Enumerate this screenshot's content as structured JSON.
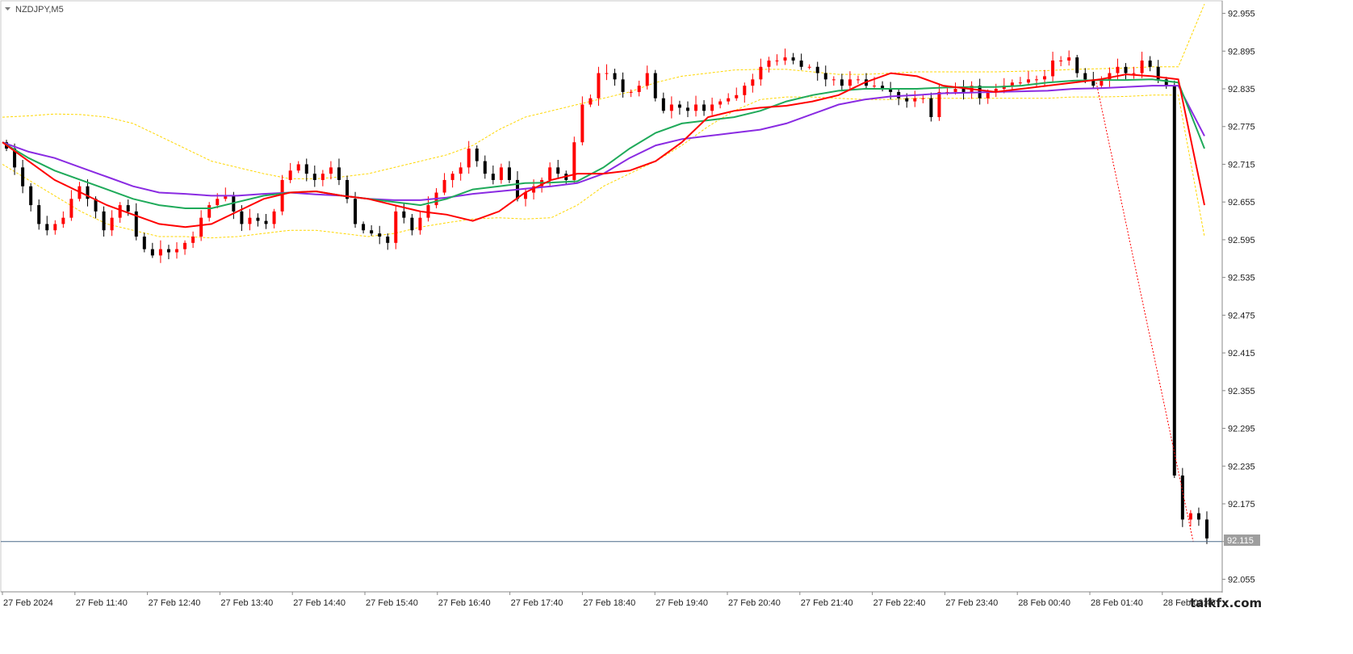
{
  "symbol_label": "NZDJPY,M5",
  "watermark": "talkfx.com",
  "colors": {
    "bull": "#ff0000",
    "bear": "#000000",
    "ma_fast": "#ff0000",
    "ma_mid": "#1faa5a",
    "ma_slow": "#8a2be2",
    "envelope": "#ffd700",
    "price_line": "#4a6a8a",
    "price_box": "#9e9e9e",
    "grid": "#e8e8e8",
    "dotted_trend": "#ff0000"
  },
  "chart_data": {
    "type": "candlestick",
    "title": "NZDJPY,M5",
    "ylim": [
      92.035,
      92.975
    ],
    "y_ticks": [
      "92.955",
      "92.895",
      "92.835",
      "92.775",
      "92.715",
      "92.655",
      "92.595",
      "92.535",
      "92.475",
      "92.415",
      "92.355",
      "92.295",
      "92.235",
      "92.175",
      "92.115",
      "92.055"
    ],
    "x_ticks": [
      "27 Feb 2024",
      "27 Feb 11:40",
      "27 Feb 12:40",
      "27 Feb 13:40",
      "27 Feb 14:40",
      "27 Feb 15:40",
      "27 Feb 16:40",
      "27 Feb 17:40",
      "27 Feb 18:40",
      "27 Feb 19:40",
      "27 Feb 20:40",
      "27 Feb 21:40",
      "27 Feb 22:40",
      "27 Feb 23:40",
      "28 Feb 00:40",
      "28 Feb 01:40",
      "28 Feb 02:40"
    ],
    "current_price": "92.115",
    "candle_closes": [
      92.74,
      92.71,
      92.68,
      92.65,
      92.62,
      92.61,
      92.62,
      92.63,
      92.66,
      92.68,
      92.66,
      92.64,
      92.61,
      92.63,
      92.65,
      92.64,
      92.6,
      92.58,
      92.57,
      92.58,
      92.575,
      92.58,
      92.59,
      92.6,
      92.63,
      92.65,
      92.66,
      92.665,
      92.64,
      92.62,
      92.63,
      92.625,
      92.62,
      92.64,
      92.69,
      92.705,
      92.715,
      92.7,
      92.69,
      92.7,
      92.71,
      92.69,
      92.66,
      92.62,
      92.61,
      92.605,
      92.6,
      92.59,
      92.64,
      92.63,
      92.61,
      92.63,
      92.65,
      92.67,
      92.69,
      92.7,
      92.71,
      92.74,
      92.72,
      92.7,
      92.69,
      92.71,
      92.69,
      92.66,
      92.67,
      92.68,
      92.69,
      92.71,
      92.7,
      92.69,
      92.75,
      92.81,
      92.82,
      92.86,
      92.86,
      92.85,
      92.83,
      92.83,
      92.84,
      92.86,
      92.82,
      92.8,
      92.81,
      92.805,
      92.8,
      92.81,
      92.8,
      92.81,
      92.815,
      92.82,
      92.825,
      92.84,
      92.85,
      92.87,
      92.88,
      92.88,
      92.885,
      92.88,
      92.87,
      92.87,
      92.86,
      92.85,
      92.85,
      92.84,
      92.85,
      92.85,
      92.84,
      92.84,
      92.835,
      92.83,
      92.82,
      92.815,
      92.82,
      92.82,
      92.79,
      92.83,
      92.83,
      92.835,
      92.83,
      92.84,
      92.82,
      92.83,
      92.835,
      92.84,
      92.845,
      92.845,
      92.85,
      92.85,
      92.855,
      92.88,
      92.88,
      92.885,
      92.86,
      92.85,
      92.84,
      92.85,
      92.86,
      92.87,
      92.86,
      92.86,
      92.88,
      92.87,
      92.85,
      92.84,
      92.22,
      92.15,
      92.16,
      92.15,
      92.12
    ],
    "ma_fast_values": [
      92.75,
      92.72,
      92.69,
      92.67,
      92.65,
      92.635,
      92.62,
      92.615,
      92.62,
      92.64,
      92.66,
      92.67,
      92.672,
      92.665,
      92.66,
      92.65,
      92.64,
      92.635,
      92.625,
      92.64,
      92.67,
      92.69,
      92.7,
      92.7,
      92.705,
      92.72,
      92.75,
      92.79,
      92.8,
      92.805,
      92.808,
      92.815,
      92.825,
      92.845,
      92.86,
      92.855,
      92.84,
      92.835,
      92.83,
      92.835,
      92.84,
      92.845,
      92.85,
      92.858,
      92.855,
      92.85,
      92.65
    ],
    "ma_mid_values": [
      92.75,
      92.725,
      92.705,
      92.69,
      92.675,
      92.66,
      92.65,
      92.645,
      92.645,
      92.655,
      92.665,
      92.67,
      92.672,
      92.665,
      92.66,
      92.655,
      92.65,
      92.66,
      92.675,
      92.68,
      92.685,
      92.686,
      92.688,
      92.71,
      92.74,
      92.765,
      92.78,
      92.785,
      92.79,
      92.8,
      92.815,
      92.825,
      92.832,
      92.835,
      92.835,
      92.835,
      92.837,
      92.838,
      92.838,
      92.84,
      92.845,
      92.848,
      92.849,
      92.849,
      92.85,
      92.845,
      92.74
    ],
    "ma_slow_values": [
      92.75,
      92.735,
      92.725,
      92.71,
      92.695,
      92.68,
      92.67,
      92.668,
      92.665,
      92.665,
      92.668,
      92.67,
      92.667,
      92.665,
      92.66,
      92.658,
      92.658,
      92.662,
      92.668,
      92.672,
      92.676,
      92.68,
      92.685,
      92.7,
      92.725,
      92.745,
      92.755,
      92.76,
      92.765,
      92.77,
      92.78,
      92.795,
      92.81,
      92.818,
      92.823,
      92.825,
      92.828,
      92.829,
      92.83,
      92.831,
      92.832,
      92.835,
      92.836,
      92.838,
      92.84,
      92.84,
      92.76
    ],
    "envelope_upper": [
      92.79,
      92.792,
      92.795,
      92.794,
      92.79,
      92.78,
      92.76,
      92.74,
      92.72,
      92.71,
      92.7,
      92.692,
      92.692,
      92.695,
      92.7,
      92.71,
      92.72,
      92.73,
      92.745,
      92.77,
      92.79,
      92.8,
      92.81,
      92.82,
      92.83,
      92.845,
      92.855,
      92.86,
      92.865,
      92.866,
      92.866,
      92.862,
      92.858,
      92.858,
      92.86,
      92.862,
      92.862,
      92.862,
      92.862,
      92.863,
      92.864,
      92.866,
      92.867,
      92.868,
      92.87,
      92.87,
      92.97
    ],
    "envelope_lower": [
      92.715,
      92.69,
      92.665,
      92.64,
      92.62,
      92.61,
      92.6,
      92.6,
      92.598,
      92.6,
      92.605,
      92.61,
      92.61,
      92.605,
      92.6,
      92.605,
      92.615,
      92.622,
      92.628,
      92.63,
      92.628,
      92.63,
      92.65,
      92.68,
      92.7,
      92.72,
      92.745,
      92.775,
      92.8,
      92.818,
      92.822,
      92.822,
      92.82,
      92.818,
      92.818,
      92.82,
      92.82,
      92.82,
      92.82,
      92.82,
      92.82,
      92.822,
      92.822,
      92.823,
      92.825,
      92.825,
      92.6
    ]
  }
}
